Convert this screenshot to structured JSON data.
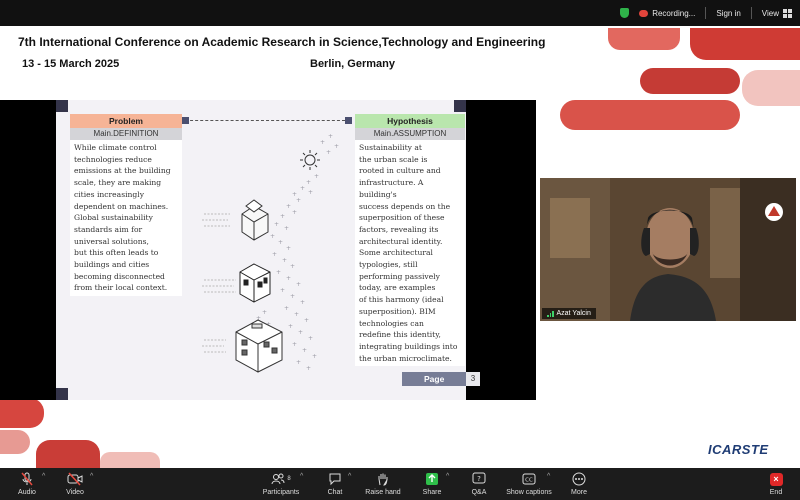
{
  "topbar": {
    "recording_label": "Recording...",
    "signin_label": "Sign in",
    "view_label": "View"
  },
  "conference": {
    "title": "7th International Conference on Academic Research in Science,Technology and Engineering",
    "dates": "13 - 15 March 2025",
    "location": "Berlin, Germany"
  },
  "slide": {
    "problem": {
      "header": "Problem",
      "subheader": "Main.DEFINITION",
      "text": "While climate control\ntechnologies reduce\nemissions at the building\nscale, they are making\ncities increasingly\ndependent on machines.\nGlobal sustainability\nstandards aim for\nuniversal solutions,\nbut this often leads to\nbuildings and cities\nbecoming disconnected\nfrom their local context."
    },
    "hypothesis": {
      "header": "Hypothesis",
      "subheader": "Main.ASSUMPTION",
      "text": "Sustainability at\nthe urban scale is\nrooted in culture and\ninfrastructure. A building's\nsuccess depends on the\nsuperposition of these\nfactors, revealing its\narchitectural identity.\nSome architectural\ntypologies, still\nperforming passively\ntoday, are examples\nof this harmony (ideal\nsuperposition). BIM\ntechnologies can\nredefine this identity,\nintegrating buildings into\nthe urban microclimate."
    },
    "page_label": "Page",
    "page_number": "3"
  },
  "video": {
    "participant_name": "Azat Yalcin"
  },
  "logo_text": "ICARSTE",
  "toolbar": {
    "audio": "Audio",
    "video": "Video",
    "participants": "Participants",
    "participants_count": "8",
    "chat": "Chat",
    "raise_hand": "Raise hand",
    "share": "Share",
    "qa": "Q&A",
    "show_captions": "Show captions",
    "more": "More",
    "end": "End"
  },
  "colors": {
    "problem_header": "#f6b496",
    "hypothesis_header": "#b9e6ad",
    "accent_red": "#d9534a",
    "end_red": "#e02828",
    "share_green": "#2fbf4a"
  }
}
